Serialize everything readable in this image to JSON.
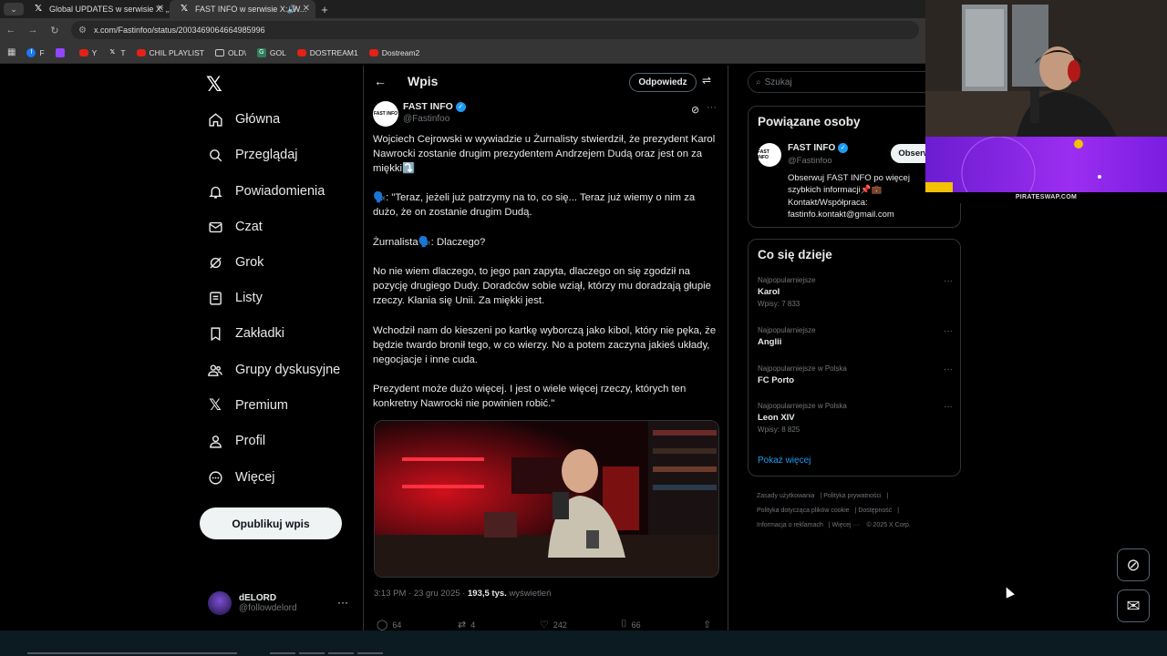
{
  "browser": {
    "tabs": [
      {
        "label": "Global UPDATES w serwisie X: „..."
      },
      {
        "label": "FAST INFO w serwisie X: „W..."
      }
    ],
    "url": "x.com/Fastinfoo/status/2003469064664985996",
    "bookmarks": [
      {
        "label": "F"
      },
      {
        "label": ""
      },
      {
        "label": "Y"
      },
      {
        "label": "T"
      },
      {
        "label": "CHIL PLAYLIST"
      },
      {
        "label": "OLD\\"
      },
      {
        "label": "GOL"
      },
      {
        "label": "DOSTREAM1"
      },
      {
        "label": "Dostream2"
      }
    ]
  },
  "nav": {
    "items": [
      {
        "label": "Główna",
        "icon": "home-icon"
      },
      {
        "label": "Przeglądaj",
        "icon": "search-icon"
      },
      {
        "label": "Powiadomienia",
        "icon": "bell-icon"
      },
      {
        "label": "Czat",
        "icon": "mail-icon"
      },
      {
        "label": "Grok",
        "icon": "grok-icon"
      },
      {
        "label": "Listy",
        "icon": "list-icon"
      },
      {
        "label": "Zakładki",
        "icon": "bookmark-icon"
      },
      {
        "label": "Grupy dyskusyjne",
        "icon": "people-icon"
      },
      {
        "label": "Premium",
        "icon": "x-icon"
      },
      {
        "label": "Profil",
        "icon": "person-icon"
      },
      {
        "label": "Więcej",
        "icon": "more-circle-icon"
      }
    ],
    "post_button": "Opublikuj wpis",
    "account": {
      "name": "dELORD",
      "handle": "@followdelord"
    }
  },
  "post": {
    "header_title": "Wpis",
    "reply_button": "Odpowiedz",
    "author_name": "FAST INFO",
    "author_handle": "@Fastinfoo",
    "paragraphs": [
      "Wojciech Cejrowski w wywiadzie u Żurnalisty stwierdził, że prezydent Karol Nawrocki zostanie drugim prezydentem Andrzejem Dudą oraz jest on za miękki⤵️",
      "🗣️: \"Teraz, jeżeli już patrzymy na to, co się... Teraz już wiemy o nim za dużo, że on zostanie drugim Dudą.",
      "Żurnalista🗣️: Dlaczego?",
      "No nie wiem dlaczego, to jego pan zapyta, dlaczego on się zgodził na pozycję drugiego Dudy. Doradców sobie wziął, którzy mu doradzają głupie rzeczy. Kłania się Unii. Za miękki jest.",
      "Wchodził nam do kieszeni po kartkę wyborczą jako kibol, który nie pęka, że będzie twardo bronił tego, w co wierzy. No a potem zaczyna jakieś układy, negocjacje i inne cuda.",
      "Prezydent może dużo więcej. I jest o wiele więcej rzeczy, których ten konkretny Nawrocki nie powinien robić.\""
    ],
    "time": "3:13 PM · 23 gru 2025",
    "views_count": "193,5 tys.",
    "views_label": "wyświetleń",
    "replies": "64",
    "reposts": "4",
    "likes": "242",
    "bookmarks": "66"
  },
  "sidebar": {
    "search_placeholder": "Szukaj",
    "related": {
      "title": "Powiązane osoby",
      "name": "FAST INFO",
      "handle": "@Fastinfoo",
      "follow": "Obserwuj",
      "bio_lines": [
        "Obserwuj FAST INFO po więcej",
        "szybkich informacji📌💼",
        "Kontakt/Współpraca:",
        "fastinfo.kontakt@gmail.com"
      ]
    },
    "trends": {
      "title": "Co się dzieje",
      "items": [
        {
          "category": "Najpopularniejsze",
          "title": "Karol",
          "count": "Wpisy: 7 833"
        },
        {
          "category": "Najpopularniejsze",
          "title": "Anglii",
          "count": ""
        },
        {
          "category": "Najpopularniejsze w Polska",
          "title": "FC Porto",
          "count": ""
        },
        {
          "category": "Najpopularniejsze w Polska",
          "title": "Leon XIV",
          "count": "Wpisy: 8 825"
        }
      ],
      "show_more": "Pokaż więcej"
    },
    "footer": [
      "Zasady użytkowania",
      "Polityka prywatności",
      "Polityka dotycząca plików cookie",
      "Dostępność",
      "Informacja o reklamach",
      "Więcej ···",
      "© 2025 X Corp."
    ]
  },
  "overlay": {
    "caption": "PIRATESWAP.COM"
  },
  "colors": {
    "accent": "#1d9bf0",
    "background": "#000000",
    "border": "#2f3336",
    "muted": "#71767b"
  }
}
